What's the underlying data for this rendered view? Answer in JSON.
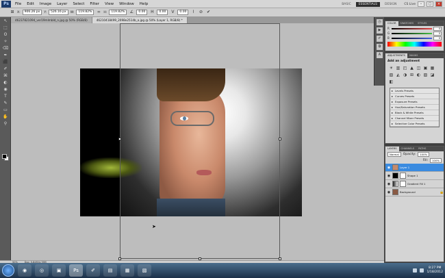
{
  "menubar": {
    "logo": "Ps",
    "items": [
      "File",
      "Edit",
      "Image",
      "Layer",
      "Select",
      "Filter",
      "View",
      "Window",
      "Help"
    ],
    "workspaces": [
      "BASIC",
      "ESSENTIALS",
      "DESIGN"
    ],
    "active_workspace": "ESSENTIALS",
    "cs_live": "CS Live",
    "window_buttons": [
      "–",
      "□",
      "×"
    ]
  },
  "options": {
    "x_label": "X:",
    "x": "906.26 px",
    "y_label": "Y:",
    "y": "526.16 px",
    "w_label": "W:",
    "w": "119.82%",
    "h_label": "H:",
    "h": "119.82%",
    "angle": "0.00",
    "hskew": "0.00",
    "vskew": "0.00"
  },
  "tabs": [
    {
      "label": "46237821094_ver19mlmbld_n.jpg @ 50% (RGB/8)",
      "active": false
    },
    {
      "label": "46210418499_2098e2514b_o.jpg @ 50% (Layer 1, RGB/8) *",
      "active": true
    }
  ],
  "tools": [
    "↖",
    "⬚",
    "ʘ",
    "✧",
    "⌫",
    "✒",
    "⬛",
    "✐",
    "⌘",
    "◐",
    "◉",
    "T",
    "✎",
    "▭",
    "✋",
    "⚲"
  ],
  "status": {
    "zoom": "50%",
    "doc": "Doc: 5.84M/4.78M"
  },
  "color_panel": {
    "tabs": [
      "COLOR",
      "SWATCHES",
      "STYLES"
    ],
    "sliders": [
      {
        "label": "R",
        "value": "0",
        "color": "#e54545"
      },
      {
        "label": "G",
        "value": "0",
        "color": "#45c045"
      },
      {
        "label": "B",
        "value": "0",
        "color": "#4560e5"
      }
    ]
  },
  "adjustments_panel": {
    "tabs": [
      "ADJUSTMENTS",
      "MASKS"
    ],
    "title": "Add an adjustment",
    "icons": [
      "☀",
      "▥",
      "◰",
      "▲",
      "◫",
      "▣",
      "▦",
      "▧",
      "◭",
      "◑",
      "⊞",
      "◐",
      "▨",
      "◪",
      "◧"
    ],
    "presets": [
      "Levels Presets",
      "Curves Presets",
      "Exposure Presets",
      "Hue/Saturation Presets",
      "Black & White Presets",
      "Channel Mixer Presets",
      "Selective Color Presets"
    ]
  },
  "layers_panel": {
    "tabs": [
      "LAYERS",
      "CHANNELS",
      "PATHS"
    ],
    "blend_mode": "Normal",
    "opacity_label": "Opacity:",
    "opacity": "100%",
    "fill_label": "Fill:",
    "fill": "100%",
    "layers": [
      {
        "name": "Layer 1",
        "active": true
      },
      {
        "name": "Shape 1",
        "active": false
      },
      {
        "name": "Gradient Fill 1",
        "active": false
      },
      {
        "name": "Background",
        "active": false
      }
    ]
  },
  "taskbar": {
    "apps": [
      "◉",
      "◎",
      "▣",
      "Ps",
      "✐",
      "▤",
      "▦",
      "▧"
    ],
    "active_app": 3,
    "time": "8:27 PM",
    "date": "1/18/2012"
  }
}
